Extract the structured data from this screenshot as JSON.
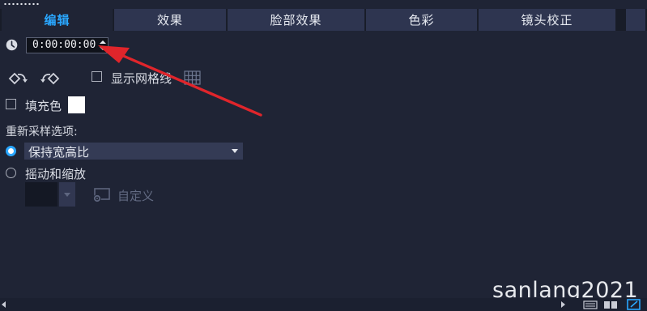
{
  "tabs": [
    {
      "label": "编辑",
      "active": true
    },
    {
      "label": "效果",
      "active": false
    },
    {
      "label": "脸部效果",
      "active": false
    },
    {
      "label": "色彩",
      "active": false
    },
    {
      "label": "镜头校正",
      "active": false
    }
  ],
  "timecode": {
    "value": "0:00:00:00"
  },
  "options": {
    "show_grid_label": "显示网格线",
    "show_grid_checked": false,
    "fill_color_label": "填充色",
    "fill_color_checked": false,
    "fill_color_value": "#ffffff"
  },
  "resample": {
    "title": "重新采样选项:",
    "keep_aspect": {
      "selected_value": "保持宽高比",
      "selected": true
    },
    "pan_zoom": {
      "label": "摇动和缩放",
      "selected": false
    },
    "custom_label": "自定义"
  },
  "watermark": "sanlang2021",
  "colors": {
    "accent": "#2aa7ff",
    "background": "#1f2435",
    "annotation_arrow": "#e0252b"
  },
  "icons": [
    "clock-icon",
    "rotate-ccw-icon",
    "rotate-cw-icon",
    "grid-icon",
    "custom-settings-icon"
  ]
}
